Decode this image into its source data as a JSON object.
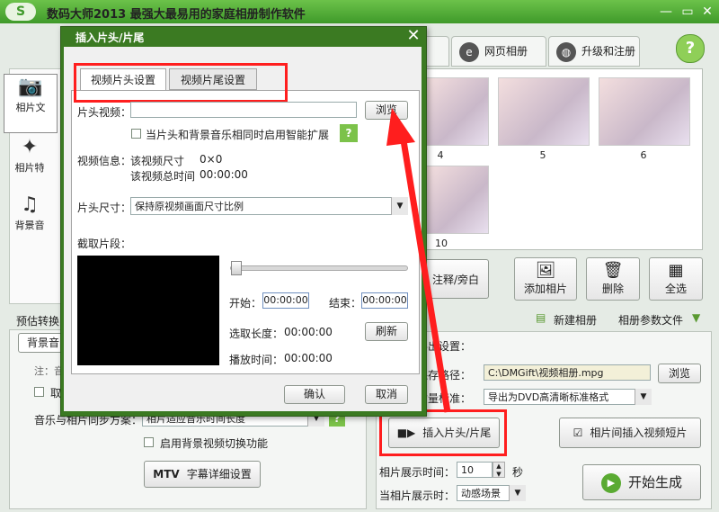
{
  "window": {
    "logo": "S",
    "title": "数码大师2013    最强大最易用的家庭相册制作软件"
  },
  "top_tabs": [
    {
      "label": "网页相册",
      "icon": "ie-icon"
    },
    {
      "label": "升级和注册",
      "icon": "globe-icon"
    }
  ],
  "help_label": "?",
  "sidebar": {
    "items": [
      {
        "label": "相片文",
        "icon": "camera-icon"
      },
      {
        "label": "相片特",
        "icon": "effects-icon"
      },
      {
        "label": "背景音",
        "icon": "music-note-icon"
      }
    ]
  },
  "photos": [
    {
      "num": "4"
    },
    {
      "num": "5"
    },
    {
      "num": "6"
    },
    {
      "num": "10"
    }
  ],
  "actions": {
    "annotate": "注释/旁白",
    "add_photo": "添加相片",
    "delete": "删除",
    "select_all": "全选"
  },
  "bar": {
    "new_album": "新建相册",
    "album_params": "相册参数文件"
  },
  "left_panel": {
    "estimate": "预估转换",
    "bg_tab": "背景音",
    "note": "注：音",
    "take_label": "取",
    "music_sync_label": "音乐与相片同步方案：",
    "music_sync_value": "相片适应音乐时间长度",
    "bg_video_switch": "启用背景视频切换功能",
    "mtv_label": "字幕详细设置",
    "mtv_badge": "MTV"
  },
  "export": {
    "header": "相册导出设置：",
    "save_path_label": "相册保存路径：",
    "save_path_value": "C:\\DMGift\\视频相册.mpg",
    "browse": "浏览",
    "quality_label": "输出质量标准：",
    "quality_value": "导出为DVD高清晰标准格式",
    "insert_head_tail": "插入片头/片尾",
    "insert_video_clip": "相片间插入视频短片",
    "display_time_label": "相片展示时间：",
    "display_time_value": "10",
    "display_time_unit": "秒",
    "scene_label": "当相片展示时：",
    "scene_value": "动感场景",
    "start": "开始生成"
  },
  "dialog": {
    "title": "插入片头/片尾",
    "tab_head": "视频片头设置",
    "tab_tail": "视频片尾设置",
    "head_video_label": "片头视频：",
    "head_video_value": "",
    "browse": "浏览",
    "smart_extend": "当片头和背景音乐相同时启用智能扩展",
    "info_label": "视频信息：",
    "size_label": "该视频尺寸",
    "size_value": "0×0",
    "duration_label": "该视频总时间",
    "duration_value": "00:00:00",
    "head_size_label": "片头尺寸：",
    "head_size_value": "保持原视频画面尺寸比例",
    "clip_label": "截取片段：",
    "start_label": "开始：",
    "start_value": "00:00:00",
    "end_label": "结束：",
    "end_value": "00:00:00",
    "select_length_label": "选取长度：",
    "select_length_value": "00:00:00",
    "refresh": "刷新",
    "play_time_label": "播放时间：",
    "play_time_value": "00:00:00",
    "ok": "确认",
    "cancel": "取消"
  },
  "colors": {
    "accent_green": "#3f9a2a",
    "highlight_red": "#ff1e1e"
  }
}
